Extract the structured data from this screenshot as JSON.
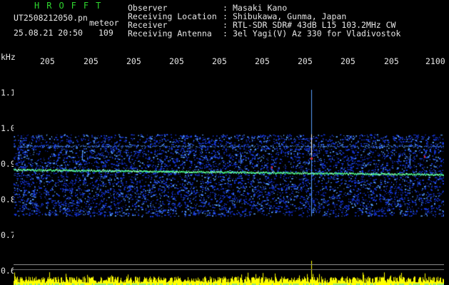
{
  "header": {
    "title": "HROFFT",
    "file_name": "UT2508212050.pn",
    "meteor_label": "meteor",
    "datetime": "25.08.21 20:50",
    "count": "109"
  },
  "info": [
    {
      "label": "Observer",
      "sep": ":",
      "value": "Masaki Kano"
    },
    {
      "label": "Receiving Location",
      "sep": ":",
      "value": "Shibukawa, Gunma, Japan"
    },
    {
      "label": "Receiver",
      "sep": ":",
      "value": "RTL-SDR SDR# 43dB L15 103.2MHz CW"
    },
    {
      "label": "Receiving Antenna",
      "sep": ":",
      "value": "3el Yagi(V) Az 330 for Vladivostok"
    }
  ],
  "axes": {
    "y_unit": "kHz",
    "y_ticks": [
      "1.1",
      "1.0",
      "0.9",
      "0.8",
      "0.7",
      "0.6"
    ],
    "x_ticks": [
      "205",
      "205",
      "205",
      "205",
      "205",
      "205",
      "205",
      "205",
      "205",
      "2100"
    ]
  },
  "spectrogram": {
    "band_kHz_top": 0.995,
    "band_kHz_bottom": 0.765,
    "tone_kHz_start": 0.897,
    "tone_kHz_end": 0.883,
    "upper_line_kHz": 0.962,
    "meteor_spike_time_fraction": 0.692,
    "colors": {
      "noise_low": "#1838d8",
      "noise_high": "#58a0ff",
      "tone": "#4cff8c",
      "baseline": "#ffff00",
      "accent": "#e83030"
    }
  }
}
